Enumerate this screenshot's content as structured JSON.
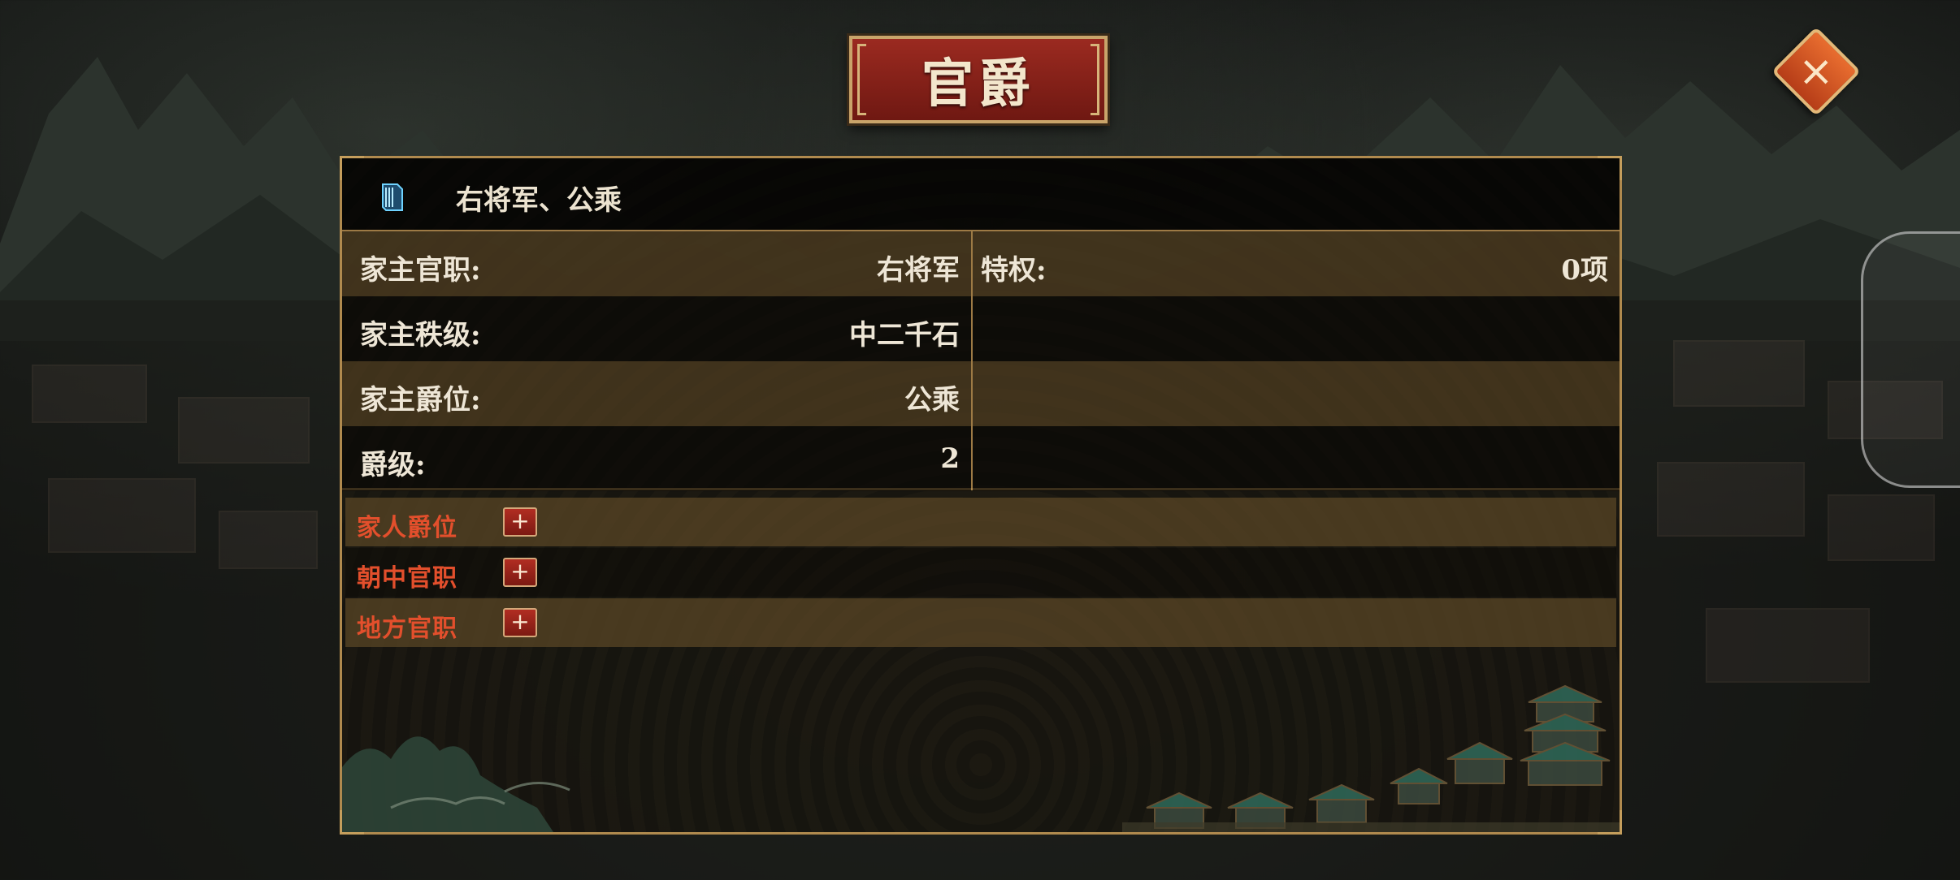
{
  "dialog": {
    "title": "官爵",
    "close_icon": "close-x-icon",
    "header_icon": "book-icon",
    "header_title": "右将军、公乘"
  },
  "left_info": [
    {
      "label": "家主官职:",
      "value": "右将军"
    },
    {
      "label": "家主秩级:",
      "value": "中二千石"
    },
    {
      "label": "家主爵位:",
      "value": "公乘"
    },
    {
      "label": "爵级:",
      "value": "2"
    }
  ],
  "right_info": [
    {
      "label": "特权:",
      "value": "0项"
    }
  ],
  "expand_sections": [
    {
      "label": "家人爵位",
      "button": "+"
    },
    {
      "label": "朝中官职",
      "button": "+"
    },
    {
      "label": "地方官职",
      "button": "+"
    }
  ],
  "colors": {
    "accent_red": "#e34f2c",
    "gold_border": "#b08a4e",
    "title_plate": "#8b241b"
  }
}
